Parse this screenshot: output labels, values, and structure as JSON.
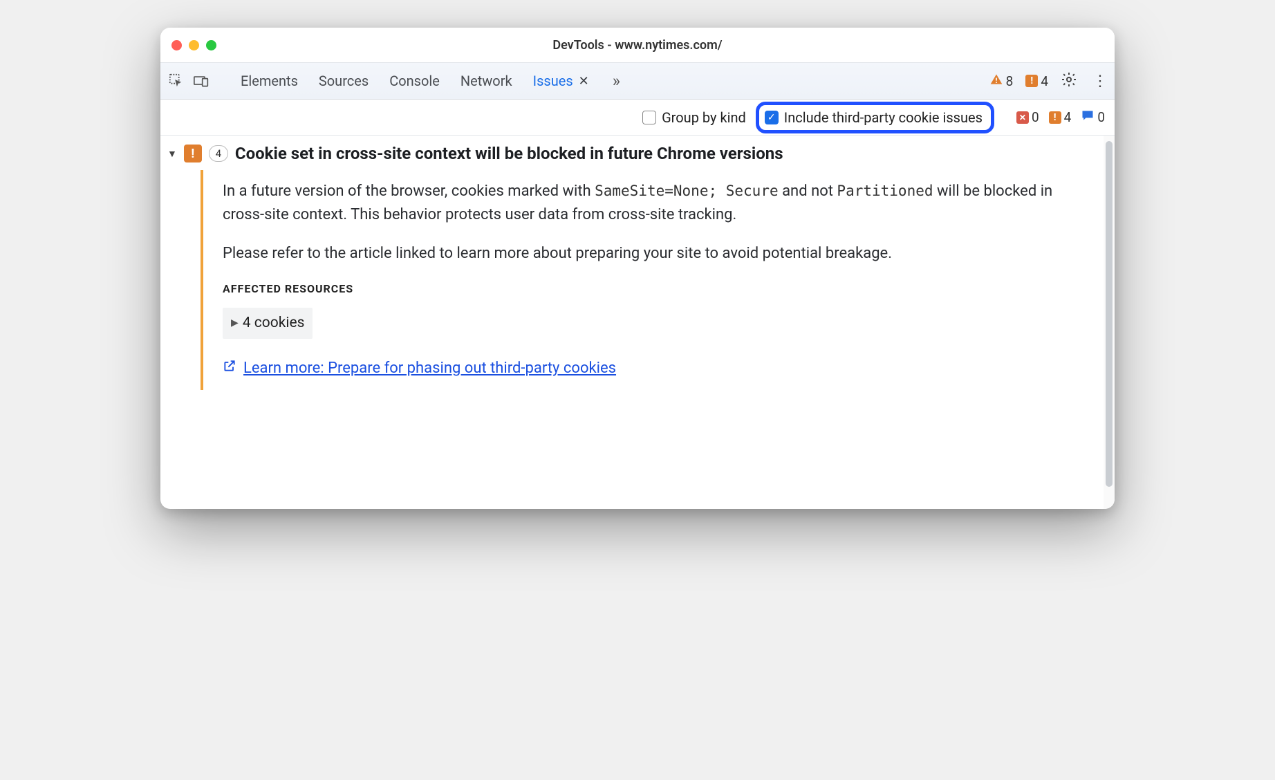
{
  "window": {
    "title": "DevTools - www.nytimes.com/"
  },
  "tabs": {
    "elements": "Elements",
    "sources": "Sources",
    "console": "Console",
    "network": "Network",
    "issues": "Issues"
  },
  "topCounts": {
    "warningsTriangle": "8",
    "warningsSquare": "4"
  },
  "filter": {
    "groupByKind": "Group by kind",
    "includeThirdParty": "Include third-party cookie issues"
  },
  "filterCounts": {
    "errors": "0",
    "warnings": "4",
    "info": "0"
  },
  "issue": {
    "count": "4",
    "title": "Cookie set in cross-site context will be blocked in future Chrome versions",
    "body1_pre": "In a future version of the browser, cookies marked with ",
    "code1": "SameSite=None; Secure",
    "body1_mid": " and not ",
    "code2": "Partitioned",
    "body1_post": " will be blocked in cross-site context. This behavior protects user data from cross-site tracking.",
    "body2": "Please refer to the article linked to learn more about preparing your site to avoid potential breakage.",
    "affectedHeading": "AFFECTED RESOURCES",
    "affectedItem": "4 cookies",
    "learnMore": "Learn more: Prepare for phasing out third-party cookies"
  }
}
